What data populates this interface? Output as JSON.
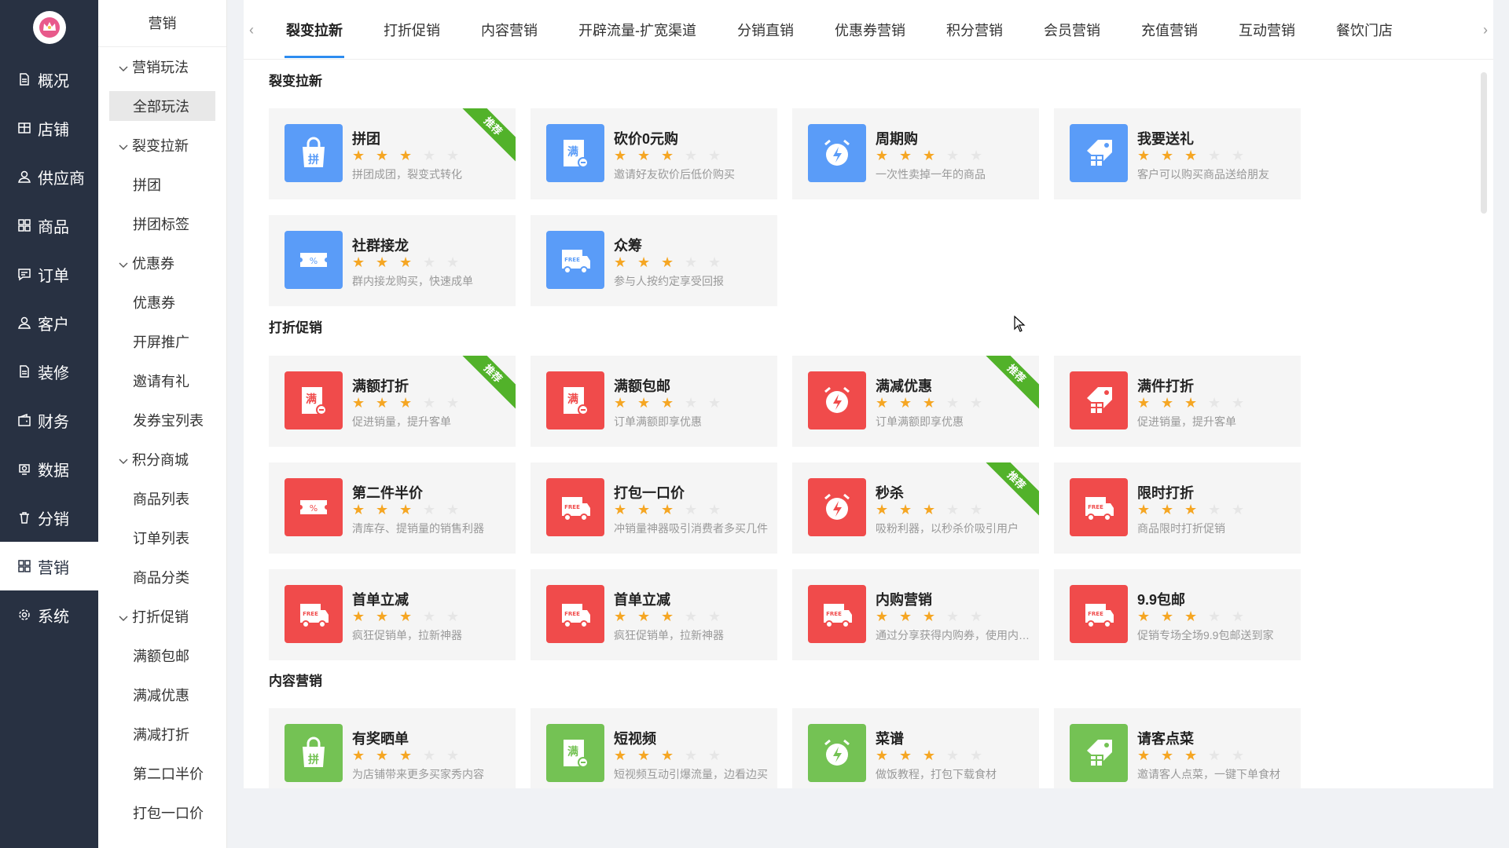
{
  "nav": {
    "items": [
      {
        "label": "概况",
        "icon": "document-icon"
      },
      {
        "label": "店铺",
        "icon": "store-icon"
      },
      {
        "label": "供应商",
        "icon": "user-icon"
      },
      {
        "label": "商品",
        "icon": "grid-icon"
      },
      {
        "label": "订单",
        "icon": "message-icon"
      },
      {
        "label": "客户",
        "icon": "user-icon"
      },
      {
        "label": "装修",
        "icon": "document-icon"
      },
      {
        "label": "财务",
        "icon": "wallet-icon"
      },
      {
        "label": "数据",
        "icon": "data-icon"
      },
      {
        "label": "分销",
        "icon": "trash-icon"
      },
      {
        "label": "营销",
        "icon": "grid-icon"
      },
      {
        "label": "系统",
        "icon": "gear-icon"
      }
    ],
    "active_index": 10
  },
  "sub": {
    "title": "营销",
    "entries": [
      {
        "type": "group",
        "label": "营销玩法"
      },
      {
        "type": "item",
        "label": "全部玩法",
        "selected": true
      },
      {
        "type": "group",
        "label": "裂变拉新"
      },
      {
        "type": "item",
        "label": "拼团"
      },
      {
        "type": "item",
        "label": "拼团标签"
      },
      {
        "type": "group",
        "label": "优惠券"
      },
      {
        "type": "item",
        "label": "优惠券"
      },
      {
        "type": "item",
        "label": "开屏推广"
      },
      {
        "type": "item",
        "label": "邀请有礼"
      },
      {
        "type": "item",
        "label": "发券宝列表"
      },
      {
        "type": "group",
        "label": "积分商城"
      },
      {
        "type": "item",
        "label": "商品列表"
      },
      {
        "type": "item",
        "label": "订单列表"
      },
      {
        "type": "item",
        "label": "商品分类"
      },
      {
        "type": "group",
        "label": "打折促销"
      },
      {
        "type": "item",
        "label": "满额包邮"
      },
      {
        "type": "item",
        "label": "满减优惠"
      },
      {
        "type": "item",
        "label": "满减打折"
      },
      {
        "type": "item",
        "label": "第二口半价"
      },
      {
        "type": "item",
        "label": "打包一口价"
      }
    ]
  },
  "tabs": [
    "裂变拉新",
    "打折促销",
    "内容营销",
    "开辟流量-扩宽渠道",
    "分销直销",
    "优惠券营销",
    "积分营销",
    "会员营销",
    "充值营销",
    "互动营销",
    "餐饮门店"
  ],
  "active_tab": 0,
  "tab_arrows": {
    "left": "‹",
    "right": "›"
  },
  "ribbon_label": "推荐",
  "star_rating": 3,
  "star_total": 5,
  "colors": {
    "blue": "#5a9cf8",
    "red": "#f04b4b",
    "green": "#74c254",
    "star": "#f5a623",
    "star_empty": "#e6e6e6",
    "ribbon": "#52b22a",
    "nav_bg": "#283142"
  },
  "sections": [
    {
      "title": "裂变拉新",
      "color": "blue",
      "cards": [
        {
          "name": "拼团",
          "desc": "拼团成团，裂变式转化",
          "icon": "bag-icon",
          "glyph": "拼",
          "ribbon": true
        },
        {
          "name": "砍价0元购",
          "desc": "邀请好友砍价后低价购买",
          "icon": "coupon-icon",
          "glyph": "满",
          "ribbon": false
        },
        {
          "name": "周期购",
          "desc": "一次性卖掉一年的商品",
          "icon": "alarm-icon",
          "glyph": "⚡",
          "ribbon": false
        },
        {
          "name": "我要送礼",
          "desc": "客户可以购买商品送给朋友",
          "icon": "gift-tag-icon",
          "glyph": "礼",
          "ribbon": false
        },
        {
          "name": "社群接龙",
          "desc": "群内接龙购买，快速成单",
          "icon": "ticket-icon",
          "glyph": "%",
          "ribbon": false
        },
        {
          "name": "众筹",
          "desc": "参与人按约定享受回报",
          "icon": "truck-icon",
          "glyph": "FREE",
          "ribbon": false
        }
      ]
    },
    {
      "title": "打折促销",
      "color": "red",
      "cards": [
        {
          "name": "满额打折",
          "desc": "促进销量，提升客单",
          "icon": "coupon-icon",
          "glyph": "满",
          "ribbon": true
        },
        {
          "name": "满额包邮",
          "desc": "订单满额即享优惠",
          "icon": "coupon-icon",
          "glyph": "满",
          "ribbon": false
        },
        {
          "name": "满减优惠",
          "desc": "订单满额即享优惠",
          "icon": "alarm-icon",
          "glyph": "⚡",
          "ribbon": true
        },
        {
          "name": "满件打折",
          "desc": "促进销量，提升客单",
          "icon": "gift-tag-icon",
          "glyph": "礼",
          "ribbon": false
        },
        {
          "name": "第二件半价",
          "desc": "清库存、提销量的销售利器",
          "icon": "ticket-icon",
          "glyph": "%",
          "ribbon": false
        },
        {
          "name": "打包一口价",
          "desc": "冲销量神器吸引消费者多买几件",
          "icon": "truck-icon",
          "glyph": "FREE",
          "ribbon": false
        },
        {
          "name": "秒杀",
          "desc": "吸粉利器，以秒杀价吸引用户",
          "icon": "alarm-icon",
          "glyph": "⚡",
          "ribbon": true
        },
        {
          "name": "限时打折",
          "desc": "商品限时打折促销",
          "icon": "truck-icon",
          "glyph": "FREE",
          "ribbon": false
        },
        {
          "name": "首单立减",
          "desc": "疯狂促销单，拉新神器",
          "icon": "truck-icon",
          "glyph": "FREE",
          "ribbon": false
        },
        {
          "name": "首单立减",
          "desc": "疯狂促销单，拉新神器",
          "icon": "truck-icon",
          "glyph": "FREE",
          "ribbon": false
        },
        {
          "name": "内购营销",
          "desc": "通过分享获得内购券，使用内购券购买",
          "icon": "truck-icon",
          "glyph": "FREE",
          "ribbon": false
        },
        {
          "name": "9.9包邮",
          "desc": "促销专场全场9.9包邮送到家",
          "icon": "truck-icon",
          "glyph": "FREE",
          "ribbon": false
        }
      ]
    },
    {
      "title": "内容营销",
      "color": "green",
      "cards": [
        {
          "name": "有奖晒单",
          "desc": "为店铺带来更多买家秀内容",
          "icon": "bag-icon",
          "glyph": "拼",
          "ribbon": false
        },
        {
          "name": "短视频",
          "desc": "短视频互动引爆流量，边看边买",
          "icon": "coupon-icon",
          "glyph": "满",
          "ribbon": false
        },
        {
          "name": "菜谱",
          "desc": "做饭教程，打包下载食材",
          "icon": "alarm-icon",
          "glyph": "⚡",
          "ribbon": false
        },
        {
          "name": "请客点菜",
          "desc": "邀请客人点菜，一键下单食材",
          "icon": "gift-tag-icon",
          "glyph": "礼",
          "ribbon": false
        }
      ]
    }
  ]
}
